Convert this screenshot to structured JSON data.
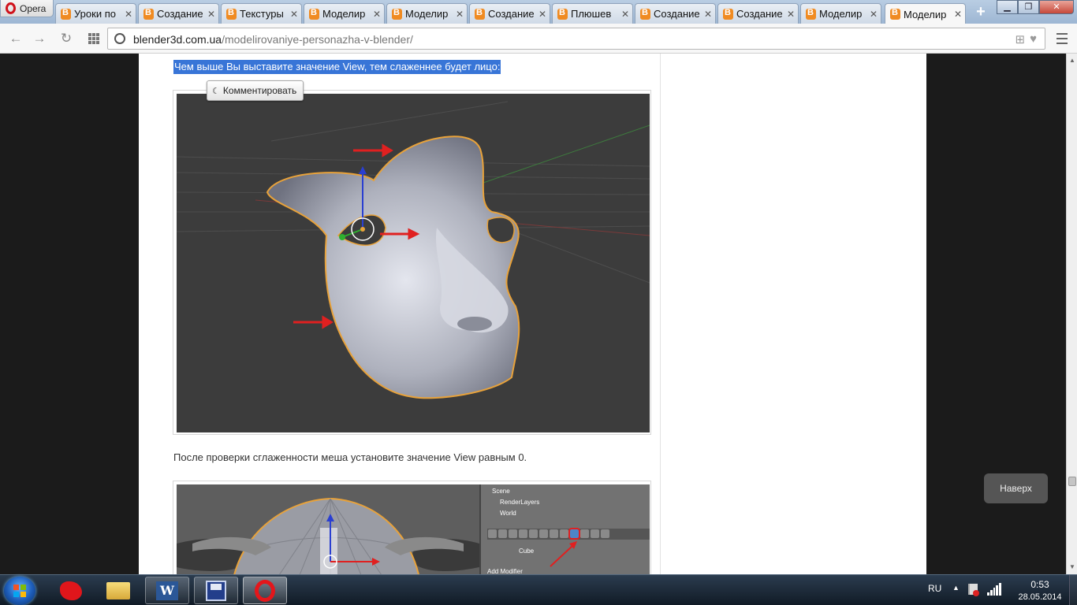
{
  "browser": {
    "app_name": "Opera",
    "tabs": [
      {
        "label": "Уроки по"
      },
      {
        "label": "Создание"
      },
      {
        "label": "Текстуры"
      },
      {
        "label": "Моделир"
      },
      {
        "label": "Моделир"
      },
      {
        "label": "Создание"
      },
      {
        "label": "Плюшев"
      },
      {
        "label": "Создание"
      },
      {
        "label": "Создание"
      },
      {
        "label": "Моделир"
      },
      {
        "label": "Моделир",
        "active": true
      }
    ],
    "new_tab_symbol": "+",
    "address": {
      "domain": "blender3d.com.ua",
      "path": "/modelirovaniye-personazha-v-blender/"
    }
  },
  "page": {
    "highlighted_text": "Чем выше Вы выставите значение View, тем слаженнее будет лицо:",
    "comment_button": "Комментировать",
    "paragraph": "После проверки сглаженности меша установите значение View равным 0.",
    "scroll_top_button": "Наверх",
    "figure2_outliner": {
      "scene": "Scene",
      "render_layers": "RenderLayers",
      "world": "World",
      "object": "Cube",
      "add_modifier": "Add Modifier"
    }
  },
  "taskbar": {
    "apps": [
      {
        "icon": "red-splat-icon"
      },
      {
        "icon": "folder-icon"
      },
      {
        "icon": "word-icon",
        "letter": "W"
      },
      {
        "icon": "save-disk-icon"
      },
      {
        "icon": "opera-icon"
      }
    ],
    "language": "RU",
    "time": "0:53",
    "date": "28.05.2014"
  },
  "colors": {
    "selection": "#3875d7",
    "mesh_outline": "#e8a23a",
    "arrow_red": "#e02020"
  }
}
